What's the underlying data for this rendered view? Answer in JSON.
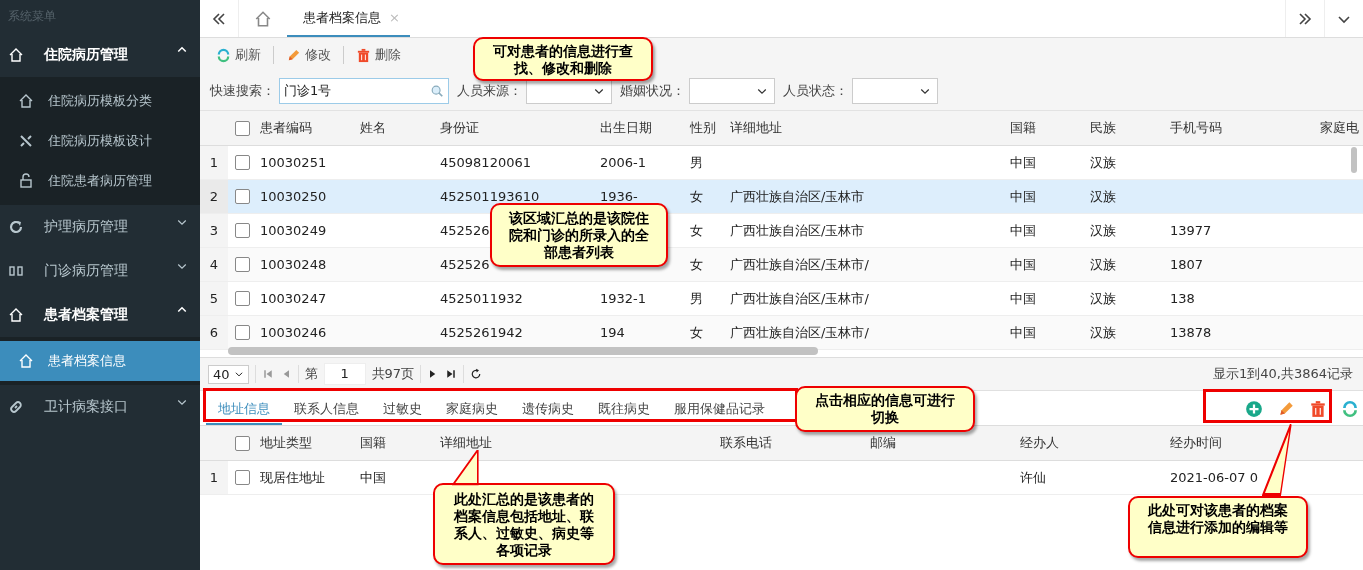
{
  "sidebar": {
    "title": "系统菜单",
    "groups": [
      {
        "label": "住院病历管理",
        "expanded": true,
        "items": [
          {
            "label": "住院病历模板分类",
            "selected": false
          },
          {
            "label": "住院病历模板设计",
            "selected": false
          },
          {
            "label": "住院患者病历管理",
            "selected": false
          }
        ]
      },
      {
        "label": "护理病历管理",
        "expanded": false
      },
      {
        "label": "门诊病历管理",
        "expanded": false
      },
      {
        "label": "患者档案管理",
        "expanded": true,
        "items": [
          {
            "label": "患者档案信息",
            "selected": true
          }
        ]
      },
      {
        "label": "卫计病案接口",
        "expanded": false
      }
    ]
  },
  "tabs": [
    {
      "label": "患者档案信息",
      "selected": true,
      "close": "×"
    }
  ],
  "toolbar": [
    {
      "label": "刷新"
    },
    {
      "label": "修改"
    },
    {
      "label": "删除"
    }
  ],
  "filters": {
    "search_label": "快速搜索：",
    "search_value": "门诊1号",
    "selects": [
      {
        "label": "人员来源："
      },
      {
        "label": "婚姻状况："
      },
      {
        "label": "人员状态："
      }
    ]
  },
  "table": {
    "all_checked": false,
    "columns": [
      "患者编码",
      "姓名",
      "身份证",
      "出生日期",
      "性别",
      "详细地址",
      "国籍",
      "民族",
      "手机号码",
      "家庭电"
    ],
    "rows": [
      {
        "n": "1",
        "selected": false,
        "checked": false,
        "cells": [
          "10030251",
          "",
          "45098120061",
          "2006-1",
          "男",
          "",
          "中国",
          "汉族",
          "",
          ""
        ]
      },
      {
        "n": "2",
        "selected": true,
        "checked": false,
        "cells": [
          "10030250",
          "",
          "452501193610",
          "1936-",
          "女",
          "广西壮族自治区/玉林市",
          "中国",
          "汉族",
          "",
          ""
        ]
      },
      {
        "n": "3",
        "selected": false,
        "checked": false,
        "cells": [
          "10030249",
          "",
          "452526",
          "",
          "女",
          "广西壮族自治区/玉林市",
          "中国",
          "汉族",
          "13977",
          ""
        ]
      },
      {
        "n": "4",
        "selected": false,
        "checked": false,
        "cells": [
          "10030248",
          "",
          "452526",
          "",
          "女",
          "广西壮族自治区/玉林市/",
          "中国",
          "汉族",
          "1807",
          ""
        ]
      },
      {
        "n": "5",
        "selected": false,
        "checked": false,
        "cells": [
          "10030247",
          "",
          "4525011932",
          "1932-1",
          "男",
          "广西壮族自治区/玉林市/",
          "中国",
          "汉族",
          "138",
          ""
        ]
      },
      {
        "n": "6",
        "selected": false,
        "checked": false,
        "cells": [
          "10030246",
          "",
          "4525261942",
          "194",
          "女",
          "广西壮族自治区/玉林市/",
          "中国",
          "汉族",
          "13878",
          ""
        ]
      }
    ]
  },
  "pager": {
    "page_size": "40",
    "page_label": "第",
    "page": "1",
    "total_pages": "共97页",
    "summary": "显示1到40,共3864记录"
  },
  "detail_tabs": [
    {
      "label": "地址信息",
      "selected": true
    },
    {
      "label": "联系人信息",
      "selected": false
    },
    {
      "label": "过敏史",
      "selected": false
    },
    {
      "label": "家庭病史",
      "selected": false
    },
    {
      "label": "遗传病史",
      "selected": false
    },
    {
      "label": "既往病史",
      "selected": false
    },
    {
      "label": "服用保健品记录",
      "selected": false
    }
  ],
  "detail_table": {
    "all_checked": false,
    "columns": [
      "地址类型",
      "国籍",
      "详细地址",
      "联系电话",
      "邮编",
      "经办人",
      "经办时间"
    ],
    "rows": [
      {
        "n": "1",
        "selected": false,
        "checked": false,
        "cells": [
          "现居住地址",
          "中国",
          "",
          "",
          "",
          "许仙",
          "2021-06-07 0"
        ]
      }
    ]
  },
  "callouts": [
    {
      "text": "可对患者的信息进行查找、修改和删除"
    },
    {
      "text": "该区域汇总的是该院住院和门诊的所录入的全部患者列表"
    },
    {
      "text": "点击相应的信息可进行切换"
    },
    {
      "text": "此处汇总的是该患者的档案信息包括地址、联系人、过敏史、病史等各项记录"
    },
    {
      "text": "此处可对该患者的档案信息进行添加的编辑等"
    }
  ]
}
